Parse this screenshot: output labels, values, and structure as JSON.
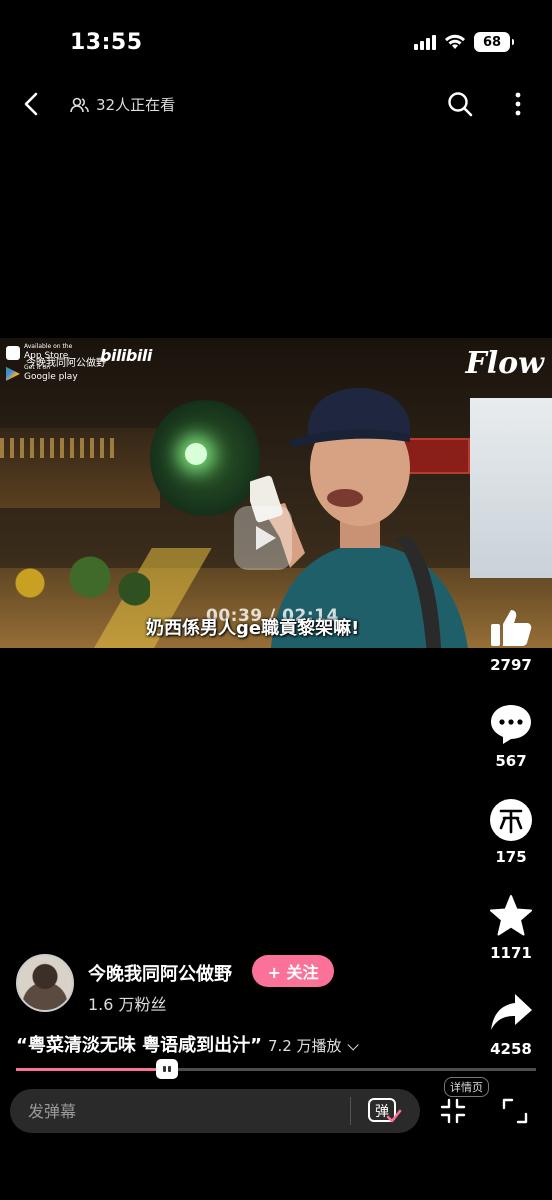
{
  "status_bar": {
    "time": "13:55",
    "battery": "68"
  },
  "top_nav": {
    "viewers": "32人正在看"
  },
  "video": {
    "timestamp": "00:39 / 02:14",
    "subtitle": "奶西係男人ge職貢黎架嘛!",
    "app_store_text": "App Store",
    "app_store_top": "Available on the",
    "google_play_top": "Get it on",
    "google_play_text": "Google play",
    "channel_watermark": "今晚我同阿公做野",
    "bilibili_logo": "bilibili",
    "flow_logo": "Flow"
  },
  "actions": [
    {
      "name": "like",
      "icon": "thumbs-up-icon",
      "count": "2797"
    },
    {
      "name": "comment",
      "icon": "comment-icon",
      "count": "567"
    },
    {
      "name": "coin",
      "icon": "coin-icon",
      "count": "175"
    },
    {
      "name": "favorite",
      "icon": "star-icon",
      "count": "1171"
    },
    {
      "name": "share",
      "icon": "share-icon",
      "count": "4258"
    }
  ],
  "uploader": {
    "name": "今晚我同阿公做野",
    "follow_label": "+ 关注",
    "fans": "1.6 万粉丝"
  },
  "video_info": {
    "title": "“粤菜清淡无味 粤语咸到出汁”",
    "plays": "7.2 万播放"
  },
  "progress": {
    "fraction": 0.29
  },
  "bottom_bar": {
    "danmu_placeholder": "发弹幕",
    "danmu_toggle_label": "弹",
    "detail_label": "详情页"
  },
  "colors": {
    "accent": "#fb7299",
    "background": "#000000"
  }
}
